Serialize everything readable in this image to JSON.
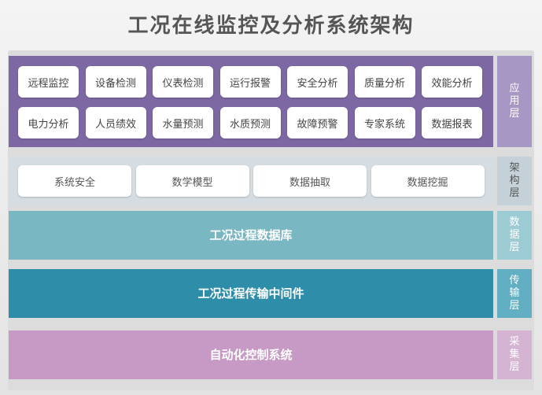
{
  "title": "工况在线监控及分析系统架构",
  "application_layer": {
    "side_label": [
      "应",
      "用",
      "层"
    ],
    "row1": [
      "远程监控",
      "设备检测",
      "仪表检测",
      "运行报警",
      "安全分析",
      "质量分析",
      "效能分析"
    ],
    "row2": [
      "电力分析",
      "人员绩效",
      "水量预测",
      "水质预测",
      "故障预警",
      "专家系统",
      "数据报表"
    ]
  },
  "architecture_layer": {
    "side_label": [
      "架",
      "构",
      "层"
    ],
    "items": [
      "系统安全",
      "数学模型",
      "数据抽取",
      "数据挖掘"
    ]
  },
  "data_layer": {
    "side_label": [
      "数",
      "据",
      "层"
    ],
    "label": "工况过程数据库"
  },
  "transport_layer": {
    "side_label": [
      "传",
      "输",
      "层"
    ],
    "label": "工况过程传输中间件"
  },
  "collection_layer": {
    "side_label": [
      "采",
      "集",
      "层"
    ],
    "label": "自动化控制系统"
  },
  "colors": {
    "application": "#7d68a3",
    "architecture": "#d5dde2",
    "data": "#79b7c3",
    "transport": "#2e8eaa",
    "collection": "#c69ac4"
  }
}
